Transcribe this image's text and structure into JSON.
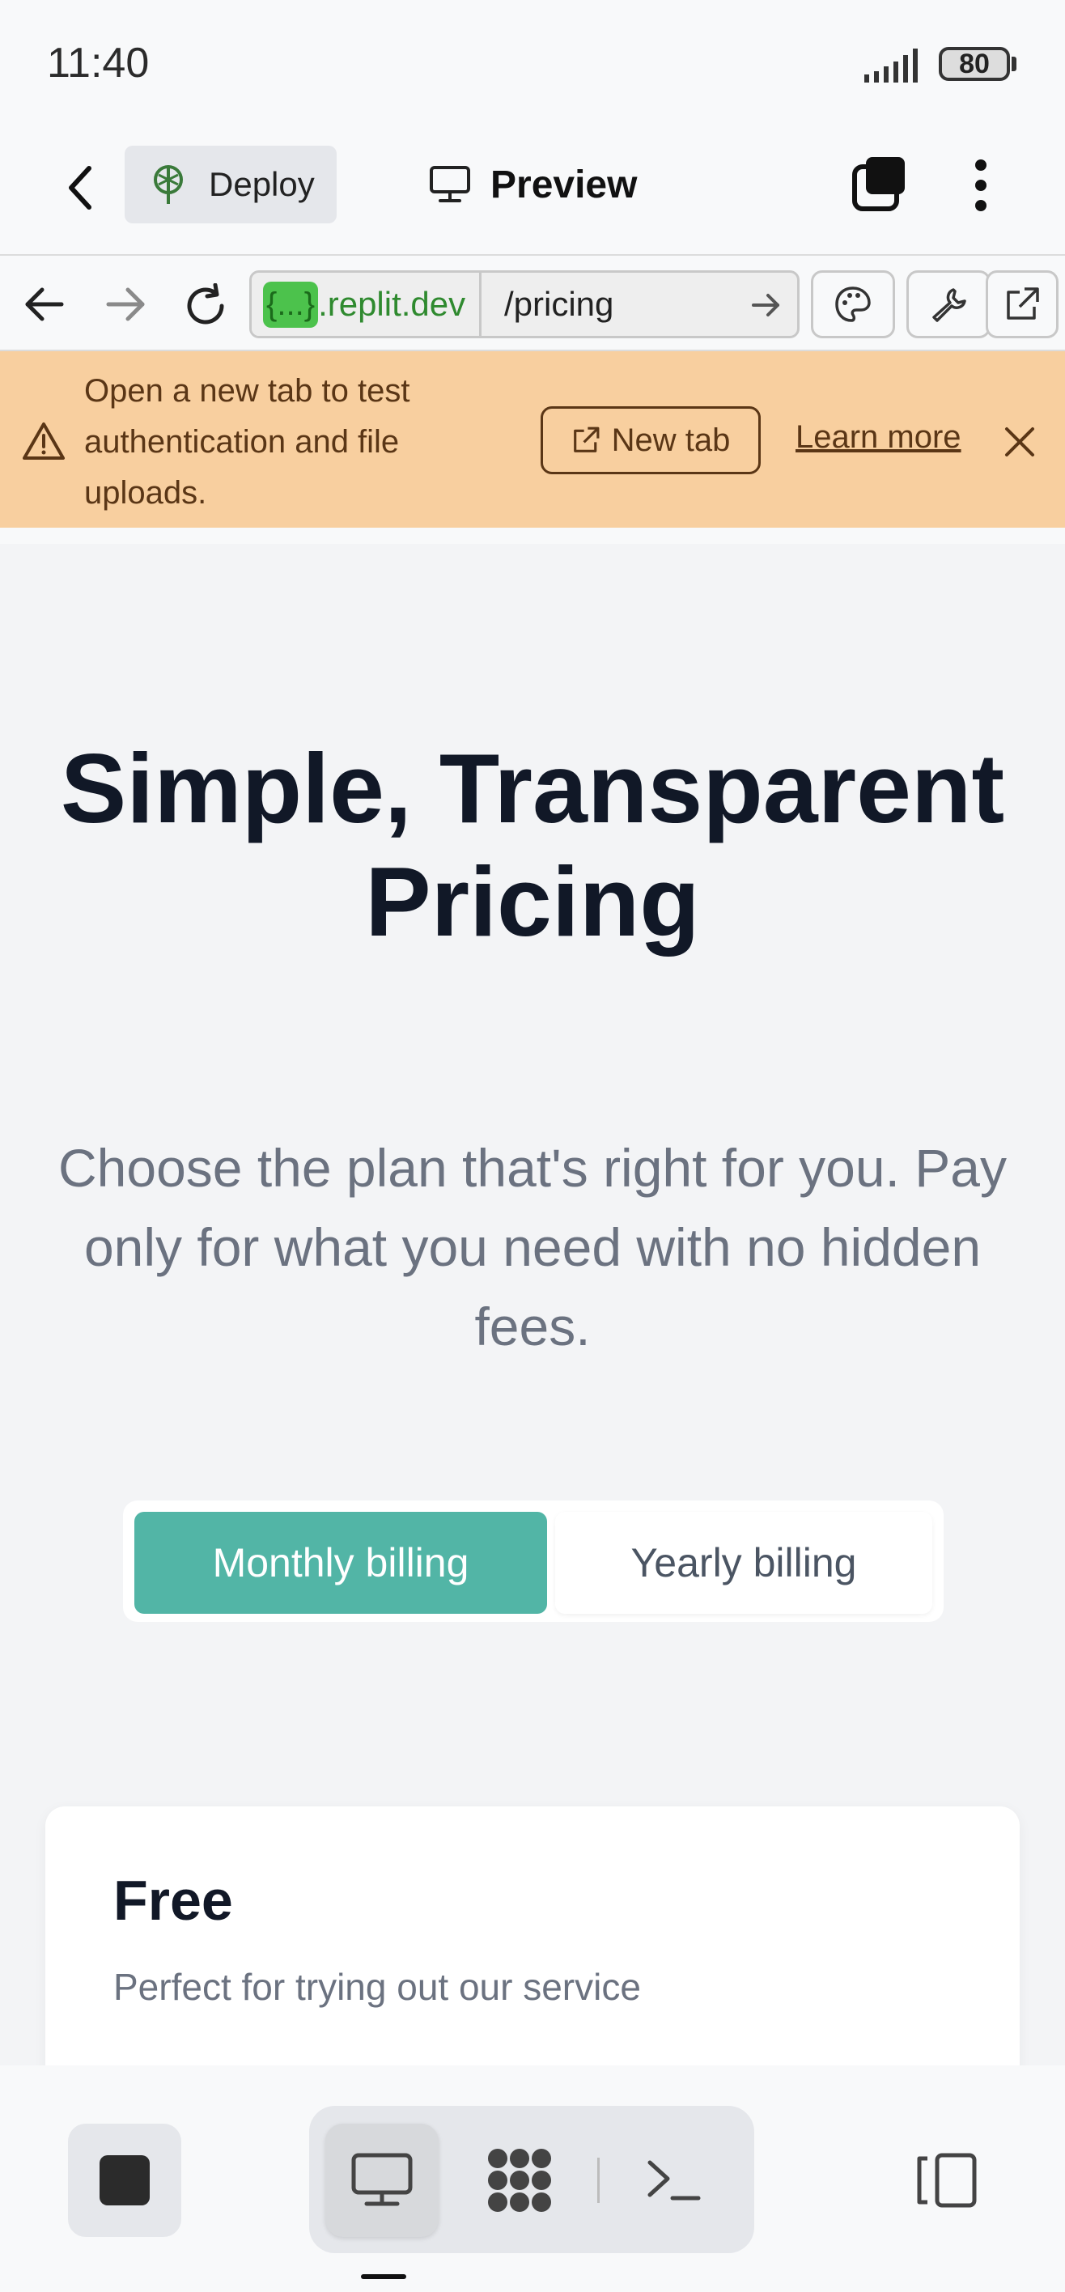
{
  "status_bar": {
    "time": "11:40",
    "battery": "80"
  },
  "app_toolbar": {
    "deploy_label": "Deploy",
    "preview_label": "Preview"
  },
  "browser": {
    "url_badge": "{...}",
    "url_host": ".replit.dev",
    "url_path": "/pricing"
  },
  "banner": {
    "message": "Open a new tab to test authentication and file uploads.",
    "new_tab_label": "New tab",
    "learn_more_label": "Learn more"
  },
  "hero": {
    "title": "Simple, Transparent Pricing",
    "subtitle": "Choose the plan that's right for you. Pay only for what you need with no hidden fees."
  },
  "billing": {
    "monthly_label": "Monthly billing",
    "yearly_label": "Yearly billing",
    "selected": "Monthly billing"
  },
  "plans": [
    {
      "name": "Free",
      "description": "Perfect for trying out our service"
    }
  ],
  "colors": {
    "accent": "#52b5a6",
    "banner": "#f8cf9f",
    "url_badge": "#4cc24c"
  },
  "icons": [
    "back-icon",
    "deploy-icon",
    "monitor-icon",
    "tabs-icon",
    "more-icon",
    "forward-icon",
    "reload-icon",
    "go-icon",
    "palette-icon",
    "wrench-icon",
    "external-link-icon",
    "warning-icon",
    "close-icon",
    "stop-icon",
    "desktop-icon",
    "agent-icon",
    "terminal-icon",
    "side-panel-icon"
  ]
}
